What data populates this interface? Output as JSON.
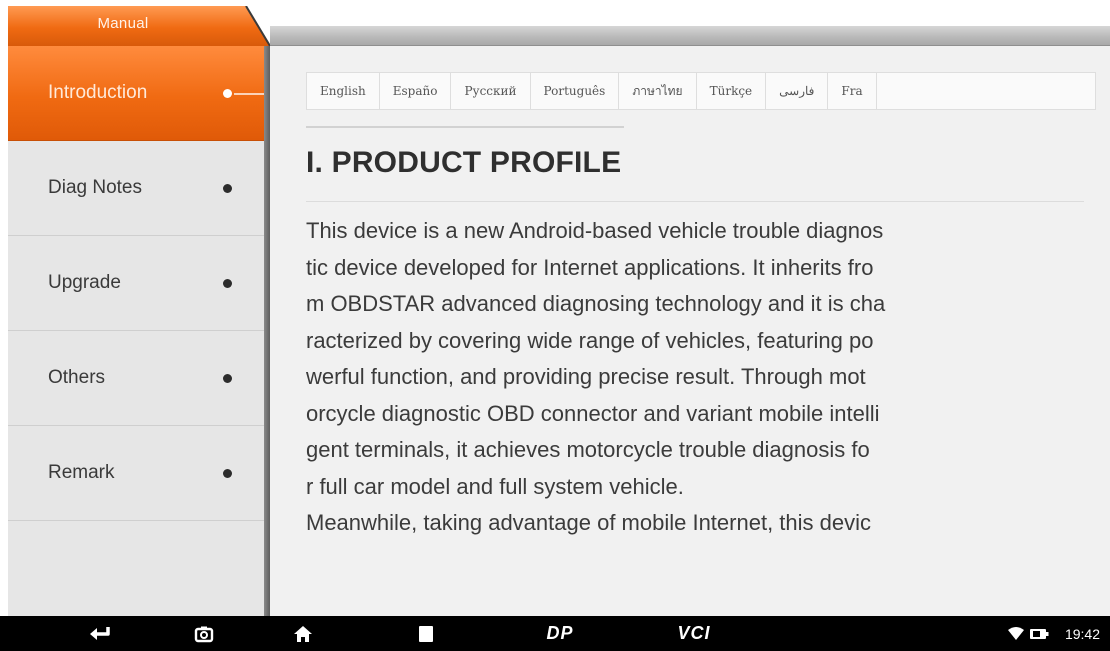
{
  "header": {
    "tab_label": "Manual"
  },
  "sidebar": {
    "items": [
      {
        "label": "Introduction",
        "active": true
      },
      {
        "label": "Diag Notes",
        "active": false
      },
      {
        "label": "Upgrade",
        "active": false
      },
      {
        "label": "Others",
        "active": false
      },
      {
        "label": "Remark",
        "active": false
      }
    ]
  },
  "languages": [
    "English",
    "Españo",
    "Русский",
    "Português",
    "ภาษาไทย",
    "Türkçe",
    "فارسی",
    "Fra"
  ],
  "document": {
    "title": "I. PRODUCT PROFILE",
    "lines": [
      "This device is a new Android-based vehicle trouble diagnos",
      "tic device developed for Internet applications. It inherits fro",
      "m OBDSTAR advanced diagnosing technology and it is cha",
      "racterized by covering wide range of vehicles, featuring po",
      "werful function, and providing precise result. Through mot",
      "orcycle diagnostic OBD connector and variant mobile intelli",
      "gent terminals, it achieves motorcycle trouble diagnosis fo",
      "r full car model and full system vehicle.",
      "Meanwhile, taking advantage of mobile Internet, this devic"
    ]
  },
  "navbar": {
    "dp_label": "DP",
    "vci_label": "VCI",
    "time": "19:42"
  },
  "colors": {
    "accent": "#f06a12",
    "sidebar_bg": "#e6e6e6",
    "content_bg": "#f1f1f1",
    "navbar_bg": "#000000"
  },
  "icons": [
    "back-icon",
    "screenshot-icon",
    "home-icon",
    "recents-icon",
    "dp-icon",
    "vci-icon",
    "wifi-icon",
    "battery-icon"
  ]
}
